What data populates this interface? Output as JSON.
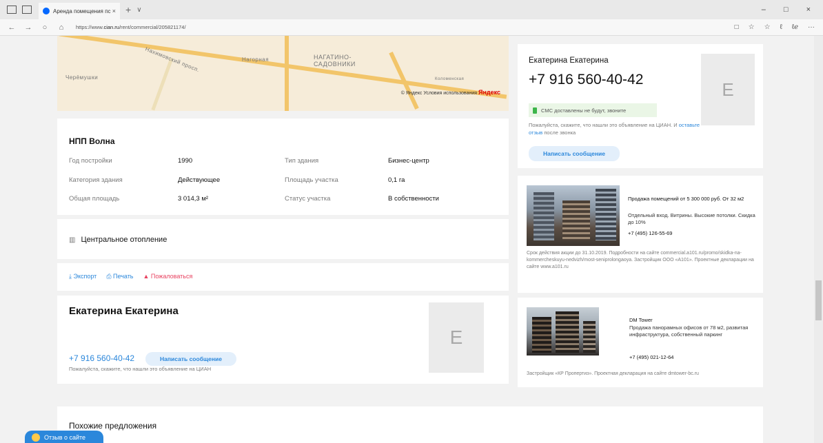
{
  "browser": {
    "tab_title": "Аренда помещения пс",
    "tab_close": "×",
    "tab_new": "+",
    "tab_chevron": "∨",
    "url_prefix": "https://www.",
    "url_host": "cian.ru",
    "url_path": "/rent/commercial/205821174/",
    "window_controls": [
      "–",
      "□",
      "×"
    ],
    "nav": [
      "←",
      "→",
      "○",
      "⌂"
    ],
    "addr_right_icons": [
      "□",
      "☆",
      "☆",
      "ℓ",
      "ℓℯ",
      "···"
    ]
  },
  "map": {
    "labels": [
      "Нагорная",
      "Нахимовский просп.",
      "НАГАТИНО-\nСАДОВНИКИ",
      "Коломенская",
      "Черёмушки"
    ],
    "copyright": "© Яндекс Условия использования",
    "brand": "Яндекс"
  },
  "building": {
    "title": "НПП Волна",
    "rows": [
      {
        "label": "Год постройки",
        "value": "1990",
        "label2": "Тип здания",
        "value2": "Бизнес-центр"
      },
      {
        "label": "Категория здания",
        "value": "Действующее",
        "label2": "Площадь участка",
        "value2": "0,1 га"
      },
      {
        "label": "Общая площадь",
        "value": "3 014,3 м²",
        "label2": "Статус участка",
        "value2": "В собственности"
      }
    ]
  },
  "heating": {
    "label": "Центральное отопление"
  },
  "actions": {
    "export": "Экспорт",
    "print": "Печать",
    "complain": "Пожаловаться"
  },
  "agent": {
    "name": "Екатерина Екатерина",
    "phone": "+7 916 560-40-42",
    "message_button": "Написать сообщение",
    "note": "Пожалуйста, скажите, что нашли это объявление на ЦИАН",
    "avatar_letter": "E"
  },
  "similar": {
    "title": "Похожие предложения"
  },
  "right_agent": {
    "name": "Екатерина Екатерина",
    "phone": "+7 916 560-40-42",
    "sms_note": "СМС доставлены не будут, звоните",
    "note_before": "Пожалуйста, скажите, что нашли это объявление на ЦИАН. И ",
    "note_link": "оставьте отзыв",
    "note_after": " после звонка",
    "message_button": "Написать сообщение",
    "avatar_letter": "E"
  },
  "ad1": {
    "title": "Продажа помещений от 5 300 000 руб. От 32 м2",
    "text": "Отдельный вход. Витрины. Высокие потолки. Скидка до 10%",
    "phone": "+7 (495) 126-55-69",
    "footer": "Срок действия акции до 31.10.2019. Подробности на сайте commercial.a101.ru/promo/skidka-na-kommercheskuyu-nedvizh/most-seniprolongaoya. Застройщик ООО «А101». Проектные декларации на сайте www.a101.ru"
  },
  "ad2": {
    "title": "DM Tower",
    "text": "Продажа панорамных офисов от 78 м2, развитая инфраструктура, собственный паркинг",
    "phone": "+7 (495) 021-12-64",
    "footer": "Застройщик «КР Пропертиз». Проектная декларация на сайте dmtower-bc.ru"
  },
  "feedback": {
    "label": "Отзыв о сайте"
  }
}
